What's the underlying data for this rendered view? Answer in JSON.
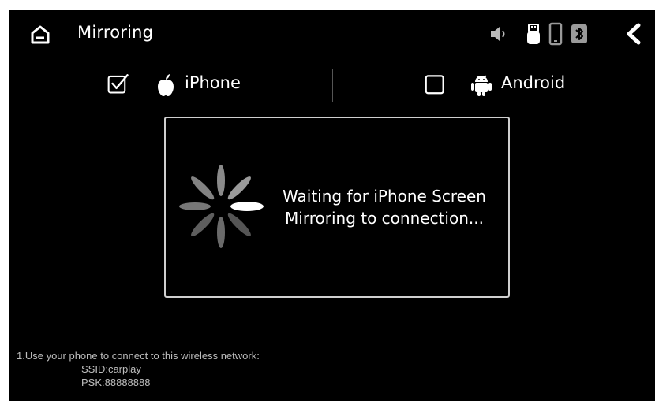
{
  "header": {
    "title": "Mirroring"
  },
  "tabs": [
    {
      "label": "iPhone",
      "checked": true
    },
    {
      "label": "Android",
      "checked": false
    }
  ],
  "status": {
    "message_line1": "Waiting for iPhone Screen",
    "message_line2": "Mirroring to connection..."
  },
  "instructions": {
    "line1": "1.Use your phone to connect to this wireless network:",
    "ssid": "SSID:carplay",
    "psk": "PSK:88888888"
  },
  "icons": {
    "home": "home-icon",
    "volume": "volume-icon",
    "usb": "usb-icon",
    "phone": "phone-icon",
    "bluetooth": "bluetooth-icon",
    "back": "back-chevron-icon",
    "apple": "apple-icon",
    "android": "android-icon",
    "spinner": "loading-spinner-icon"
  },
  "colors": {
    "background": "#000000",
    "text": "#ffffff",
    "muted_text": "#bdbdbd",
    "panel_border": "#cfcfcf"
  }
}
